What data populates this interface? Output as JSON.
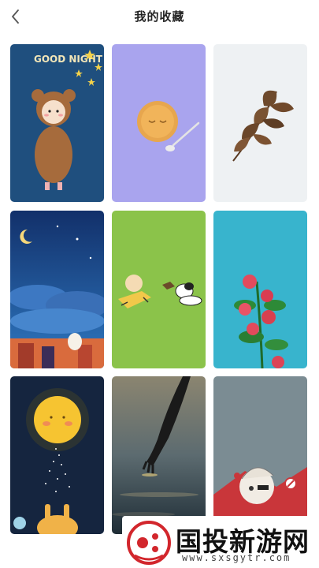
{
  "header": {
    "title": "我的收藏",
    "back_icon": "chevron-left-icon"
  },
  "wallpapers": [
    {
      "name": "good-night-bear-girl",
      "text": "GOOD NIGHT"
    },
    {
      "name": "tart-on-purple"
    },
    {
      "name": "brown-leaf-on-white"
    },
    {
      "name": "night-sky-bunny"
    },
    {
      "name": "charlie-brown-snoopy-grass"
    },
    {
      "name": "red-roses-on-teal"
    },
    {
      "name": "glowing-moon-bunny"
    },
    {
      "name": "hand-in-water"
    },
    {
      "name": "anime-character-gray"
    }
  ],
  "watermark": {
    "brand": "国投新游网",
    "url": "www.sxsgytr.com"
  },
  "colors": {
    "accent_red": "#d2262c"
  }
}
